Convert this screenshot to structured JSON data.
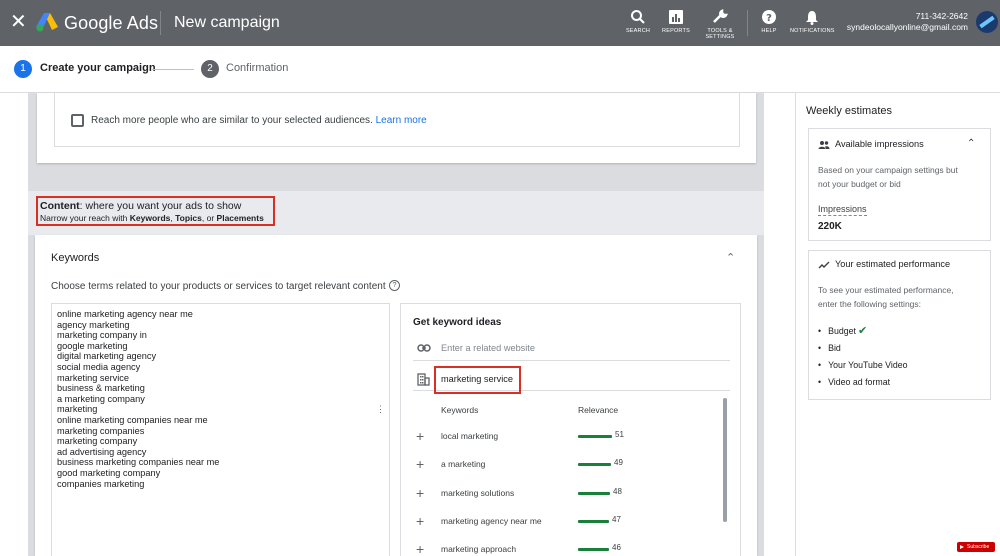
{
  "header": {
    "close_glyph": "✕",
    "brand": "Google Ads",
    "page_title": "New campaign",
    "tools": [
      {
        "name": "search",
        "label": "SEARCH"
      },
      {
        "name": "reports",
        "label": "REPORTS"
      },
      {
        "name": "tools",
        "label": "TOOLS &\nSETTINGS"
      },
      {
        "name": "help",
        "label": "HELP"
      },
      {
        "name": "notifications",
        "label": "NOTIFICATIONS"
      }
    ],
    "account_phone": "711-342-2642",
    "account_email": "syndeolocallyonline@gmail.com"
  },
  "stepper": {
    "step1_num": "1",
    "step1_label": "Create your campaign",
    "step2_num": "2",
    "step2_label": "Confirmation"
  },
  "audience": {
    "similar_text": "Reach more people who are similar to your selected audiences.",
    "learn_more": "Learn more"
  },
  "content_section": {
    "title_bold": "Content",
    "title_rest": ": where you want your ads to show",
    "sub_prefix": "Narrow your reach with ",
    "sub_keywords": "Keywords",
    "sub_sep1": ", ",
    "sub_topics": "Topics",
    "sub_sep2": ", or ",
    "sub_placements": "Placements"
  },
  "keywords": {
    "title": "Keywords",
    "instructions": "Choose terms related to your products or services to target relevant content",
    "list": [
      "online marketing agency near me",
      "agency marketing",
      "marketing company in",
      "google marketing",
      "digital marketing agency",
      "social media agency",
      "marketing service",
      "business & marketing",
      "a marketing company",
      "marketing",
      "online marketing companies near me",
      "marketing companies",
      "marketing company",
      "ad advertising agency",
      "business marketing companies near me",
      "good marketing company",
      "companies marketing"
    ]
  },
  "ideas": {
    "title": "Get keyword ideas",
    "website_placeholder": "Enter a related website",
    "service_value": "marketing service",
    "col_keywords": "Keywords",
    "col_relevance": "Relevance",
    "rows": [
      {
        "keyword": "local marketing",
        "relevance": 51
      },
      {
        "keyword": "a marketing",
        "relevance": 49
      },
      {
        "keyword": "marketing solutions",
        "relevance": 48
      },
      {
        "keyword": "marketing agency near me",
        "relevance": 47
      },
      {
        "keyword": "marketing approach",
        "relevance": 46
      }
    ]
  },
  "sidebar": {
    "weekly_title": "Weekly estimates",
    "impressions_card": {
      "title": "Available impressions",
      "text_line1": "Based on your campaign settings but",
      "text_line2": "not your budget or bid",
      "label": "Impressions",
      "value": "220K"
    },
    "performance_card": {
      "title": "Your estimated performance",
      "text_line1": "To see your estimated performance,",
      "text_line2": "enter the following settings:",
      "items": [
        "Budget",
        "Bid",
        "Your YouTube Video",
        "Video ad format"
      ]
    }
  },
  "youtube_badge": "Subscribe",
  "colors": {
    "topbar": "#5f6368",
    "accent": "#1a73e8",
    "highlight": "#d93025",
    "relevance_bar": "#188038"
  }
}
